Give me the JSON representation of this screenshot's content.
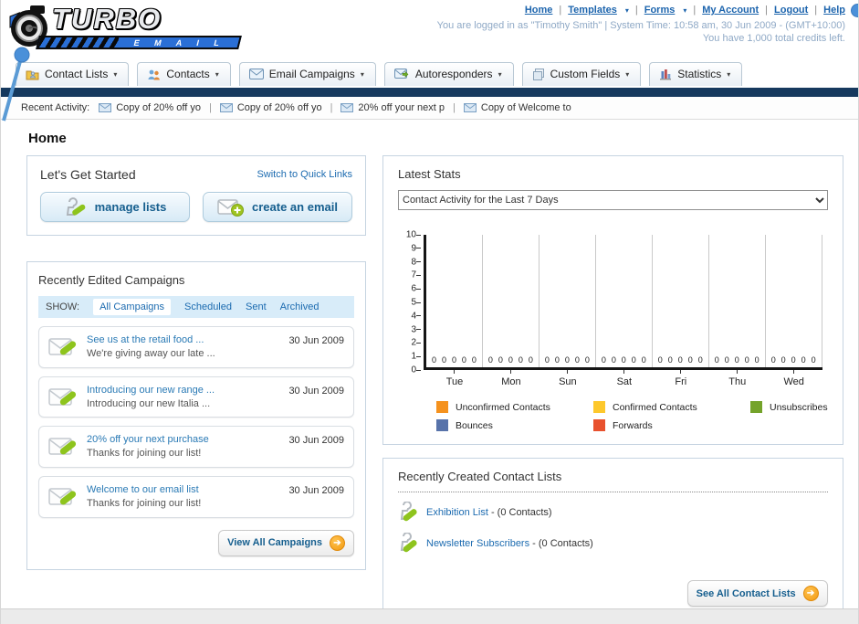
{
  "colors": {
    "navy": "#16395e",
    "link": "#1c6bb0",
    "accent_orange": "#f29b13"
  },
  "header": {
    "logo_title": "TURBO",
    "logo_subtitle": "E M A I L",
    "links": [
      {
        "label": "Home",
        "dropdown": false
      },
      {
        "label": "Templates",
        "dropdown": true
      },
      {
        "label": "Forms",
        "dropdown": true
      },
      {
        "label": "My Account",
        "dropdown": false
      },
      {
        "label": "Logout",
        "dropdown": false
      },
      {
        "label": "Help",
        "dropdown": false
      }
    ],
    "login_line": "You are logged in as \"Timothy Smith\" | System Time: 10:58 am, 30 Jun 2009 - (GMT+10:00)",
    "credits_line": "You have 1,000 total credits left."
  },
  "nav": {
    "tabs": [
      {
        "label": "Contact Lists",
        "icon": "folder-user-icon"
      },
      {
        "label": "Contacts",
        "icon": "people-icon"
      },
      {
        "label": "Email Campaigns",
        "icon": "envelope-icon"
      },
      {
        "label": "Autoresponders",
        "icon": "envelope-arrow-icon"
      },
      {
        "label": "Custom Fields",
        "icon": "pages-icon"
      },
      {
        "label": "Statistics",
        "icon": "bar-chart-icon"
      }
    ]
  },
  "recent_activity": {
    "label": "Recent Activity:",
    "items": [
      "Copy of 20% off yo",
      "Copy of 20% off yo",
      "20% off your next p",
      "Copy of Welcome to"
    ]
  },
  "page_title": "Home",
  "get_started": {
    "title": "Let's Get Started",
    "switch_link": "Switch to Quick Links",
    "manage_button": "manage lists",
    "create_button": "create an email"
  },
  "campaigns": {
    "title": "Recently Edited Campaigns",
    "show_label": "SHOW:",
    "filters": [
      "All Campaigns",
      "Scheduled",
      "Sent",
      "Archived"
    ],
    "active_filter": 0,
    "items": [
      {
        "title": "See us at the retail food ...",
        "subtitle": "We're giving away our late ...",
        "date": "30 Jun 2009"
      },
      {
        "title": "Introducing our new range ...",
        "subtitle": "Introducing our new Italia ...",
        "date": "30 Jun 2009"
      },
      {
        "title": "20% off your next purchase",
        "subtitle": "Thanks for joining our list!",
        "date": "30 Jun 2009"
      },
      {
        "title": "Welcome to our email list",
        "subtitle": "Thanks for joining our list!",
        "date": "30 Jun 2009"
      }
    ],
    "view_all": "View All Campaigns"
  },
  "stats": {
    "title": "Latest Stats",
    "dropdown_value": "Contact Activity for the Last 7 Days"
  },
  "chart_data": {
    "type": "bar",
    "title": "Contact Activity for the Last 7 Days",
    "categories": [
      "Tue",
      "Mon",
      "Sun",
      "Sat",
      "Fri",
      "Thu",
      "Wed"
    ],
    "series": [
      {
        "name": "Unconfirmed Contacts",
        "color": "#f5921e",
        "values": [
          0,
          0,
          0,
          0,
          0,
          0,
          0
        ]
      },
      {
        "name": "Confirmed Contacts",
        "color": "#fdc82c",
        "values": [
          0,
          0,
          0,
          0,
          0,
          0,
          0
        ]
      },
      {
        "name": "Unsubscribes",
        "color": "#74a32a",
        "values": [
          0,
          0,
          0,
          0,
          0,
          0,
          0
        ]
      },
      {
        "name": "Bounces",
        "color": "#5873aa",
        "values": [
          0,
          0,
          0,
          0,
          0,
          0,
          0
        ]
      },
      {
        "name": "Forwards",
        "color": "#e8512e",
        "values": [
          0,
          0,
          0,
          0,
          0,
          0,
          0
        ]
      }
    ],
    "ylim": [
      0,
      10
    ],
    "yticks": [
      0,
      1,
      2,
      3,
      4,
      5,
      6,
      7,
      8,
      9,
      10
    ],
    "grid": "vertical",
    "legend_position": "bottom",
    "value_labels": "0 shown above baseline for every bar"
  },
  "contact_lists": {
    "title": "Recently Created Contact Lists",
    "items": [
      {
        "name": "Exhibition List",
        "detail": "- (0 Contacts)"
      },
      {
        "name": "Newsletter Subscribers",
        "detail": "- (0 Contacts)"
      }
    ],
    "see_all": "See All Contact Lists"
  }
}
